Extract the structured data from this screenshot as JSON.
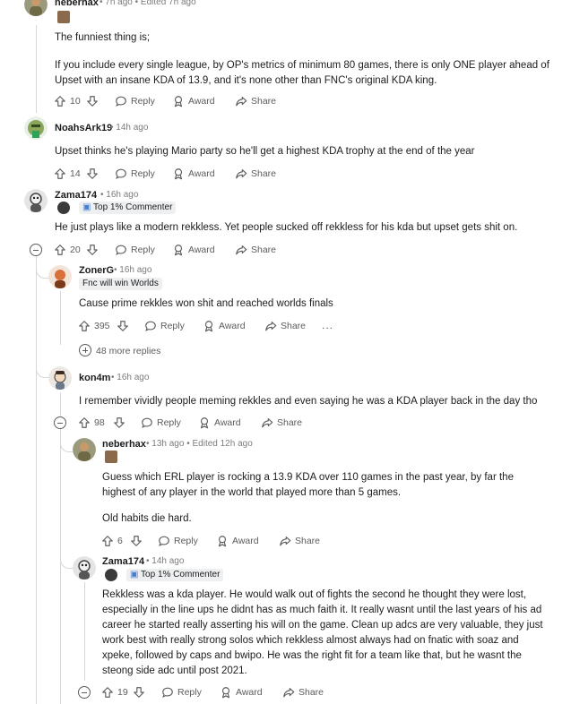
{
  "c1": {
    "user": "neberhax",
    "meta": "• 7h ago • Edited 7h ago",
    "p1": "The funniest thing is;",
    "p2": "If you include every single league, by OP's metrics of minimum 80 games, there is only ONE player ahead of Upset with an insane KDA of 13.9, and it's none other than FNC's original KDA king.",
    "votes": "10",
    "reply": "Reply",
    "award": "Award",
    "share": "Share"
  },
  "c2": {
    "user": "NoahsArk19",
    "meta": "• 14h ago",
    "p1": "Upset thinks he's playing Mario party so he'll get a highest KDA trophy at the end of the year",
    "votes": "14",
    "reply": "Reply",
    "award": "Award",
    "share": "Share"
  },
  "c3": {
    "user": "Zama174",
    "meta": "• 16h ago",
    "flair": "Top 1% Commenter",
    "p1": "He just plays like a modern rekkless. Yet people sucked off rekkless for his kda but upset gets shit on.",
    "votes": "20",
    "reply": "Reply",
    "award": "Award",
    "share": "Share"
  },
  "c4": {
    "user": "ZonerG",
    "meta": "• 16h ago",
    "flair": "Fnc will win Worlds",
    "p1": "Cause prime rekkles won shit and reached worlds finals",
    "votes": "395",
    "reply": "Reply",
    "award": "Award",
    "share": "Share",
    "more": "..."
  },
  "more_replies": "48 more replies",
  "c5": {
    "user": "kon4m",
    "meta": "• 16h ago",
    "p1": "I remember vividly people meming rekkles and even saying he was a KDA player back in the day tho",
    "votes": "98",
    "reply": "Reply",
    "award": "Award",
    "share": "Share"
  },
  "c6": {
    "user": "neberhax",
    "meta": "• 13h ago • Edited 12h ago",
    "p1": "Guess which ERL player is rocking a 13.9 KDA over 110 games in the past year, by far the highest of any player in the world that played more than 5 games.",
    "p2": "Old habits die hard.",
    "votes": "6",
    "reply": "Reply",
    "award": "Award",
    "share": "Share"
  },
  "c7": {
    "user": "Zama174",
    "meta": "• 14h ago",
    "flair": "Top 1% Commenter",
    "p1": "Rekkless was a kda player. He would walk out of fights the second he thought they were lost, especially in the line ups he didnt has as much faith it. It really wasnt until the last years of his ad career he started really asserting his will on the game. Clean up adcs are very valuable, they just work best with really strong solos which rekkless almost always had on fnatic with soaz and xpeke, followed by caps and bwipo. He was the right fit for a team like that, but he wasnt the steong side adc until post 2021.",
    "votes": "19",
    "reply": "Reply",
    "award": "Award",
    "share": "Share"
  }
}
